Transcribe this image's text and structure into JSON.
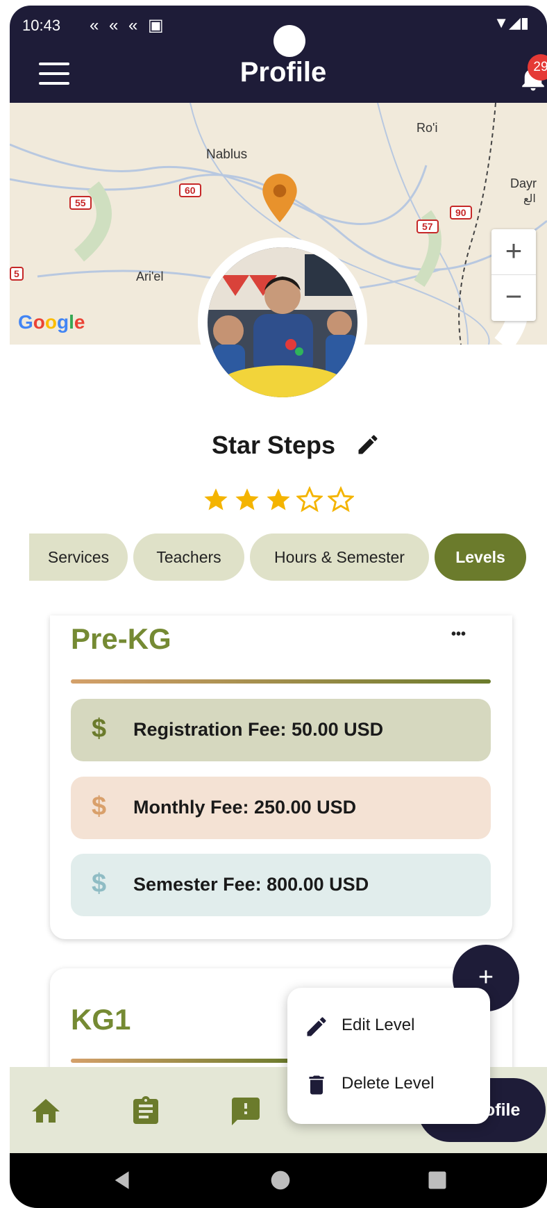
{
  "status_bar": {
    "time": "10:43",
    "icons": "« « « ▣",
    "right_icons": "▼◢▮"
  },
  "header": {
    "title": "Profile",
    "notification_count": "29"
  },
  "map": {
    "labels": [
      "Ro'i",
      "Nablus",
      "Dayr",
      "الع",
      "Ari'el"
    ],
    "roads": [
      "60",
      "55",
      "90",
      "57",
      "5"
    ],
    "zoom_in": "+",
    "zoom_out": "−"
  },
  "profile": {
    "name": "Star Steps",
    "rating": 3,
    "rating_max": 5
  },
  "tabs": [
    {
      "label": "Services",
      "active": false
    },
    {
      "label": "Teachers",
      "active": false
    },
    {
      "label": "Hours & Semester",
      "active": false
    },
    {
      "label": "Levels",
      "active": true
    }
  ],
  "levels": [
    {
      "name": "Pre-KG",
      "more": "•••",
      "fees": [
        {
          "text": "Registration Fee: 50.00 USD",
          "symbol": "$"
        },
        {
          "text": "Monthly Fee: 250.00 USD",
          "symbol": "$"
        },
        {
          "text": "Semester Fee: 800.00 USD",
          "symbol": "$"
        }
      ]
    },
    {
      "name": "KG1"
    }
  ],
  "fab": "+",
  "popup_menu": {
    "edit": "Edit Level",
    "delete": "Delete Level"
  },
  "bottom_nav": {
    "profile_label": "ofile",
    "icons": [
      "home-icon",
      "clipboard-icon",
      "feedback-icon"
    ]
  },
  "colors": {
    "primary": "#1e1c38",
    "olive": "#6b7b2c",
    "accent_green": "#758a33",
    "chip": "#dfe1c8",
    "fee_reg": "#d6d8bf",
    "fee_month": "#f4e2d4",
    "fee_sem": "#e1edec",
    "badge": "#e53935",
    "star": "#f4b400"
  }
}
